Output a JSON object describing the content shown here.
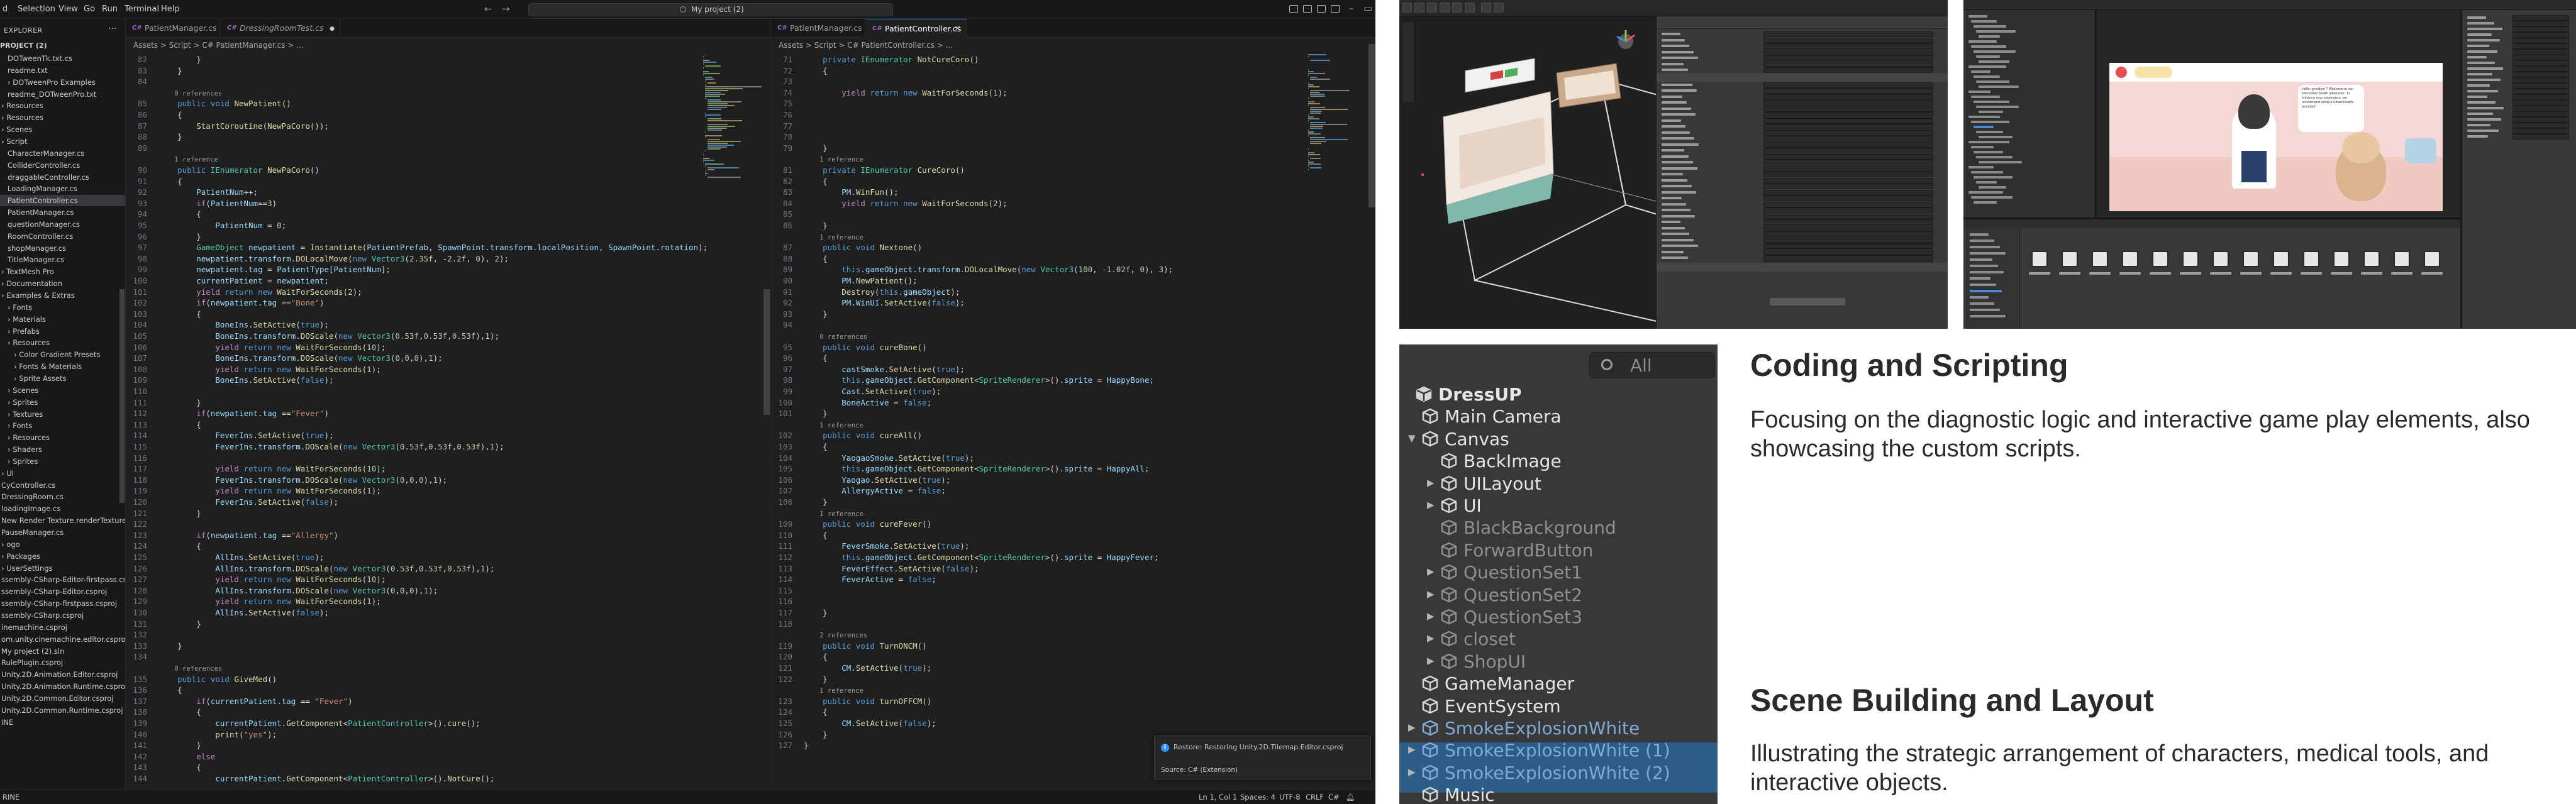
{
  "menubar": {
    "items": [
      "d",
      "Selection",
      "View",
      "Go",
      "Run",
      "Terminal",
      "Help"
    ],
    "search": "My project (2)"
  },
  "explorer": {
    "title": "EXPLORER",
    "project": "PROJECT (2)",
    "items": [
      "DOTweenTk.txt.cs",
      "readme.txt",
      "DOTweenPro Examples",
      "readme_DOTweenPro.txt",
      "Resources",
      "Resources",
      "Scenes",
      "Script",
      "CharacterManager.cs",
      "ColliderController.cs",
      "draggableController.cs",
      "LoadingManager.cs",
      "PatientController.cs",
      "PatientManager.cs",
      "questionManager.cs",
      "RoomController.cs",
      "shopManager.cs",
      "TitleManager.cs",
      "TextMesh Pro",
      "Documentation",
      "Examples & Extras",
      "Fonts",
      "Materials",
      "Prefabs",
      "Resources",
      "Color Gradient Presets",
      "Fonts & Materials",
      "Sprite Assets",
      "Scenes",
      "Sprites",
      "Textures",
      "Fonts",
      "Resources",
      "Shaders",
      "Sprites",
      "UI",
      "CyController.cs",
      "DressingRoom.cs",
      "loadingImage.cs",
      "New Render Texture.renderTexture",
      "PauseManager.cs",
      "ogo",
      "Packages",
      "UserSettings",
      "ssembly-CSharp-Editor-firstpass.cs...",
      "ssembly-CSharp-Editor.csproj",
      "ssembly-CSharp-firstpass.csproj",
      "ssembly-CSharp.csproj",
      "inemachine.csproj",
      "om.unity.cinemachine.editor.csproj",
      "My project (2).sln",
      "RulePlugin.csproj",
      "Unity.2D.Animation.Editor.csproj",
      "Unity.2D.Animation.Runtime.csproj",
      "Unity.2D.Common.Editor.csproj",
      "Unity.2D.Common.Runtime.csproj",
      "INE"
    ]
  },
  "editor_left": {
    "tabs": [
      "PatientManager.cs",
      "DressingRoomTest.cs"
    ],
    "breadcrumb": "Assets > Script > C# PatientManager.cs > ...",
    "lines": [
      {
        "n": "",
        "t": "        }"
      },
      {
        "n": "",
        "t": "    }"
      },
      {
        "n": "",
        "t": ""
      },
      {
        "n": "",
        "t": "    0 references"
      },
      {
        "n": "",
        "t": "    public void NewPatient()"
      },
      {
        "n": "",
        "t": "    {"
      },
      {
        "n": "",
        "t": "        StartCoroutine(NewPaCoro());"
      },
      {
        "n": "",
        "t": "    }"
      },
      {
        "n": "",
        "t": ""
      },
      {
        "n": "",
        "t": "    1 reference"
      },
      {
        "n": "",
        "t": "    public IEnumerator NewPaCoro()"
      },
      {
        "n": "",
        "t": "    {"
      },
      {
        "n": "",
        "t": "        PatientNum++;"
      },
      {
        "n": "",
        "t": "        if(PatientNum==3)"
      },
      {
        "n": "",
        "t": "        {"
      },
      {
        "n": "",
        "t": "            PatientNum = 0;"
      },
      {
        "n": "",
        "t": "        }"
      },
      {
        "n": "",
        "t": "        GameObject newpatient = Instantiate(PatientPrefab, SpawnPoint.transform.localPosition, SpawnPoint.rotation);"
      },
      {
        "n": "",
        "t": "        newpatient.transform.DOLocalMove(new Vector3(2.35f, -2.2f, 0), 2);"
      },
      {
        "n": "",
        "t": "        newpatient.tag = PatientType[PatientNum];"
      },
      {
        "n": "",
        "t": "        currentPatient = newpatient;"
      },
      {
        "n": "",
        "t": "        yield return new WaitForSeconds(2);"
      },
      {
        "n": "",
        "t": "        if(newpatient.tag ==\"Bone\")"
      },
      {
        "n": "",
        "t": "        {"
      },
      {
        "n": "",
        "t": "            BoneIns.SetActive(true);"
      },
      {
        "n": "",
        "t": "            BoneIns.transform.DOScale(new Vector3(0.53f,0.53f,0.53f),1);"
      },
      {
        "n": "",
        "t": "            yield return new WaitForSeconds(10);"
      },
      {
        "n": "",
        "t": "            BoneIns.transform.DOScale(new Vector3(0,0,0),1);"
      },
      {
        "n": "",
        "t": "            yield return new WaitForSeconds(1);"
      },
      {
        "n": "",
        "t": "            BoneIns.SetActive(false);"
      },
      {
        "n": "",
        "t": ""
      },
      {
        "n": "",
        "t": "        }"
      },
      {
        "n": "",
        "t": "        if(newpatient.tag ==\"Fever\")"
      },
      {
        "n": "",
        "t": "        {"
      },
      {
        "n": "",
        "t": "            FeverIns.SetActive(true);"
      },
      {
        "n": "",
        "t": "            FeverIns.transform.DOScale(new Vector3(0.53f,0.53f,0.53f),1);"
      },
      {
        "n": "",
        "t": ""
      },
      {
        "n": "",
        "t": "            yield return new WaitForSeconds(10);"
      },
      {
        "n": "",
        "t": "            FeverIns.transform.DOScale(new Vector3(0,0,0),1);"
      },
      {
        "n": "",
        "t": "            yield return new WaitForSeconds(1);"
      },
      {
        "n": "",
        "t": "            FeverIns.SetActive(false);"
      },
      {
        "n": "",
        "t": "        }"
      },
      {
        "n": "",
        "t": ""
      },
      {
        "n": "",
        "t": "        if(newpatient.tag ==\"Allergy\")"
      },
      {
        "n": "",
        "t": "        {"
      },
      {
        "n": "",
        "t": "            AllIns.SetActive(true);"
      },
      {
        "n": "",
        "t": "            AllIns.transform.DOScale(new Vector3(0.53f,0.53f,0.53f),1);"
      },
      {
        "n": "",
        "t": "            yield return new WaitForSeconds(10);"
      },
      {
        "n": "",
        "t": "            AllIns.transform.DOScale(new Vector3(0,0,0),1);"
      },
      {
        "n": "",
        "t": "            yield return new WaitForSeconds(1);"
      },
      {
        "n": "",
        "t": "            AllIns.SetActive(false);"
      },
      {
        "n": "",
        "t": "        }"
      },
      {
        "n": "",
        "t": ""
      },
      {
        "n": "",
        "t": "    }"
      },
      {
        "n": "",
        "t": ""
      },
      {
        "n": "",
        "t": "    0 references"
      },
      {
        "n": "",
        "t": "    public void GiveMed()"
      },
      {
        "n": "",
        "t": "    {"
      },
      {
        "n": "",
        "t": "        if(currentPatient.tag == \"Fever\")"
      },
      {
        "n": "",
        "t": "        {"
      },
      {
        "n": "",
        "t": "            currentPatient.GetComponent<PatientController>().cure();"
      },
      {
        "n": "",
        "t": "            print(\"yes\");"
      },
      {
        "n": "",
        "t": "        }"
      },
      {
        "n": "",
        "t": "        else"
      },
      {
        "n": "",
        "t": "        {"
      },
      {
        "n": "",
        "t": "            currentPatient.GetComponent<PatientController>().NotCure();"
      }
    ]
  },
  "editor_right": {
    "tabs": [
      "PatientManager.cs",
      "PatientController.cs"
    ],
    "breadcrumb": "Assets > Script > C# PatientController.cs > ...",
    "lines": [
      {
        "n": "71",
        "t": "    private IEnumerator NotCureCoro()"
      },
      {
        "n": "72",
        "t": "    {"
      },
      {
        "n": "73",
        "t": ""
      },
      {
        "n": "74",
        "t": "        yield return new WaitForSeconds(1);"
      },
      {
        "n": "75",
        "t": ""
      },
      {
        "n": "76",
        "t": ""
      },
      {
        "n": "77",
        "t": ""
      },
      {
        "n": "78",
        "t": ""
      },
      {
        "n": "79",
        "t": "    }"
      },
      {
        "n": "80",
        "t": "    1 reference"
      },
      {
        "n": "81",
        "t": "    private IEnumerator CureCoro()"
      },
      {
        "n": "82",
        "t": "    {"
      },
      {
        "n": "83",
        "t": "        PM.WinFun();"
      },
      {
        "n": "84",
        "t": "        yield return new WaitForSeconds(2);"
      },
      {
        "n": "85",
        "t": ""
      },
      {
        "n": "86",
        "t": "    }"
      },
      {
        "n": "",
        "t": "    1 reference"
      },
      {
        "n": "87",
        "t": "    public void Nextone()"
      },
      {
        "n": "88",
        "t": "    {"
      },
      {
        "n": "89",
        "t": "        this.gameObject.transform.DOLocalMove(new Vector3(100, -1.02f, 0), 3);"
      },
      {
        "n": "90",
        "t": "        PM.NewPatient();"
      },
      {
        "n": "91",
        "t": "        Destroy(this.gameObject);"
      },
      {
        "n": "92",
        "t": "        PM.WinUI.SetActive(false);"
      },
      {
        "n": "93",
        "t": "    }"
      },
      {
        "n": "94",
        "t": ""
      },
      {
        "n": "",
        "t": "    0 references"
      },
      {
        "n": "95",
        "t": "    public void cureBone()"
      },
      {
        "n": "96",
        "t": "    {"
      },
      {
        "n": "97",
        "t": "        castSmoke.SetActive(true);"
      },
      {
        "n": "98",
        "t": "        this.gameObject.GetComponent<SpriteRenderer>().sprite = HappyBone;"
      },
      {
        "n": "99",
        "t": "        Cast.SetActive(true);"
      },
      {
        "n": "100",
        "t": "        BoneActive = false;"
      },
      {
        "n": "101",
        "t": "    }"
      },
      {
        "n": "",
        "t": "    1 reference"
      },
      {
        "n": "102",
        "t": "    public void cureAll()"
      },
      {
        "n": "103",
        "t": "    {"
      },
      {
        "n": "104",
        "t": "        YaogaoSmoke.SetActive(true);"
      },
      {
        "n": "105",
        "t": "        this.gameObject.GetComponent<SpriteRenderer>().sprite = HappyAll;"
      },
      {
        "n": "106",
        "t": "        Yaogao.SetActive(true);"
      },
      {
        "n": "107",
        "t": "        AllergyActive = false;"
      },
      {
        "n": "108",
        "t": "    }"
      },
      {
        "n": "",
        "t": "    1 reference"
      },
      {
        "n": "109",
        "t": "    public void cureFever()"
      },
      {
        "n": "110",
        "t": "    {"
      },
      {
        "n": "111",
        "t": "        FeverSmoke.SetActive(true);"
      },
      {
        "n": "112",
        "t": "        this.gameObject.GetComponent<SpriteRenderer>().sprite = HappyFever;"
      },
      {
        "n": "113",
        "t": "        FeverEffect.SetActive(false);"
      },
      {
        "n": "114",
        "t": "        FeverActive = false;"
      },
      {
        "n": "115",
        "t": ""
      },
      {
        "n": "116",
        "t": ""
      },
      {
        "n": "117",
        "t": "    }"
      },
      {
        "n": "118",
        "t": ""
      },
      {
        "n": "",
        "t": "    2 references"
      },
      {
        "n": "119",
        "t": "    public void TurnONCM()"
      },
      {
        "n": "120",
        "t": "    {"
      },
      {
        "n": "121",
        "t": "        CM.SetActive(true);"
      },
      {
        "n": "122",
        "t": "    }"
      },
      {
        "n": "",
        "t": "    1 reference"
      },
      {
        "n": "123",
        "t": "    public void turnOFFCM()"
      },
      {
        "n": "124",
        "t": "    {"
      },
      {
        "n": "125",
        "t": "        CM.SetActive(false);"
      },
      {
        "n": "126",
        "t": "    }"
      },
      {
        "n": "127",
        "t": "}"
      }
    ]
  },
  "notification": {
    "text": "Restore: Restoring Unity.2D.Tilemap.Editor.csproj",
    "source": "Source: C# (Extension)"
  },
  "statusbar": {
    "left": "RINE",
    "items": [
      "Ln 1, Col 1",
      "Spaces: 4",
      "UTF-8",
      "CRLF",
      "C#"
    ]
  },
  "game_dialog": {
    "text": "Hello, goodbye ? Welcome to our interactive health adventure. To enhance your experience, we recommend using a Smart health assistant"
  },
  "hierarchy": {
    "search_placeholder": "All",
    "items": [
      {
        "label": "DressUP",
        "indent": 0,
        "arrow": "",
        "style": "scene"
      },
      {
        "label": "Main Camera",
        "indent": 1,
        "arrow": "",
        "style": "active"
      },
      {
        "label": "Canvas",
        "indent": 1,
        "arrow": "down",
        "style": "active"
      },
      {
        "label": "BackImage",
        "indent": 2,
        "arrow": "",
        "style": "active"
      },
      {
        "label": "UILayout",
        "indent": 2,
        "arrow": "right",
        "style": "active"
      },
      {
        "label": "UI",
        "indent": 2,
        "arrow": "right",
        "style": "active"
      },
      {
        "label": "BlackBackground",
        "indent": 2,
        "arrow": "",
        "style": "inactive"
      },
      {
        "label": "ForwardButton",
        "indent": 2,
        "arrow": "",
        "style": "inactive"
      },
      {
        "label": "QuestionSet1",
        "indent": 2,
        "arrow": "right",
        "style": "inactive"
      },
      {
        "label": "QuestionSet2",
        "indent": 2,
        "arrow": "right",
        "style": "inactive"
      },
      {
        "label": "QuestionSet3",
        "indent": 2,
        "arrow": "right",
        "style": "inactive"
      },
      {
        "label": "closet",
        "indent": 2,
        "arrow": "right",
        "style": "inactive"
      },
      {
        "label": "ShopUI",
        "indent": 2,
        "arrow": "right",
        "style": "inactive"
      },
      {
        "label": "GameManager",
        "indent": 1,
        "arrow": "",
        "style": "active"
      },
      {
        "label": "EventSystem",
        "indent": 1,
        "arrow": "",
        "style": "active"
      },
      {
        "label": "SmokeExplosionWhite",
        "indent": 1,
        "arrow": "right",
        "style": "prefab-inactive"
      },
      {
        "label": "SmokeExplosionWhite (1)",
        "indent": 1,
        "arrow": "right",
        "style": "prefab-inactive"
      },
      {
        "label": "SmokeExplosionWhite (2)",
        "indent": 1,
        "arrow": "right",
        "style": "prefab-inactive"
      },
      {
        "label": "Music",
        "indent": 1,
        "arrow": "",
        "style": "active"
      }
    ]
  },
  "sections": [
    {
      "title": "Coding and Scripting",
      "body": "Focusing on the diagnostic logic and interactive game play elements, also showcasing the custom scripts."
    },
    {
      "title": "Scene Building and Layout",
      "body": "Illustrating the strategic arrangement of characters, medical tools, and interactive objects."
    }
  ],
  "colors": {
    "keyword": "#569cd6",
    "type": "#4ec9b0",
    "method": "#dcdcaa",
    "string": "#ce9178",
    "number": "#b5cea8",
    "variable": "#9cdcfe",
    "control": "#c586c0",
    "codelens": "#999999",
    "text": "#d4d4d4"
  }
}
